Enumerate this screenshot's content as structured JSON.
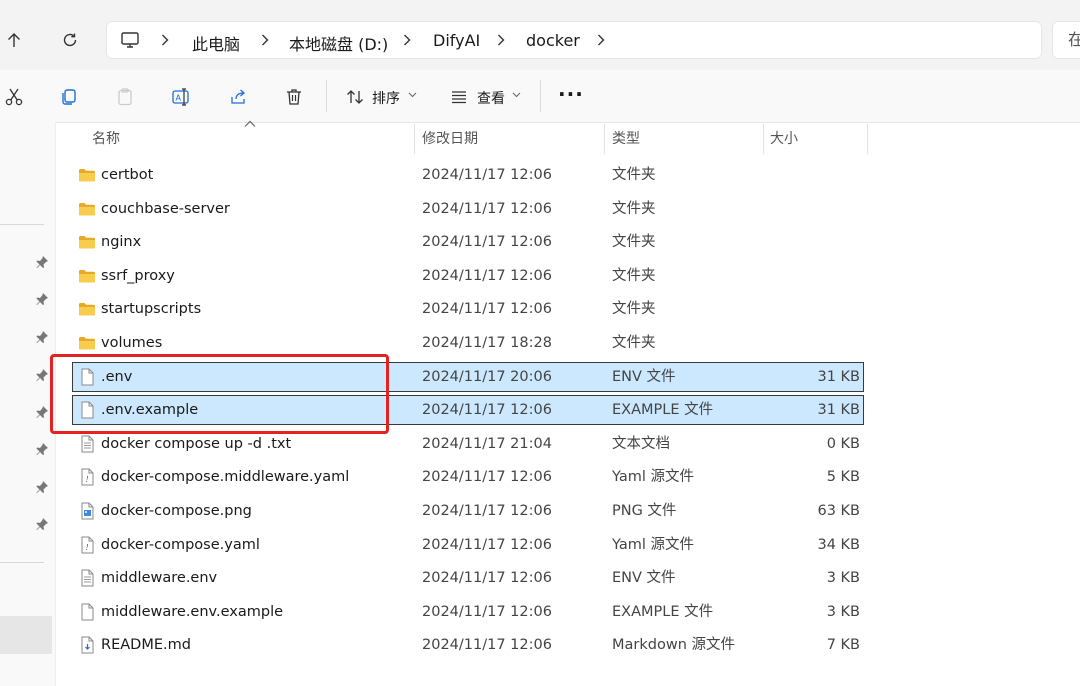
{
  "address": {
    "breadcrumbs": [
      "此电脑",
      "本地磁盘 (D:)",
      "DifyAI",
      "docker"
    ],
    "search_placeholder": "在"
  },
  "toolbar": {
    "sort_label": "排序",
    "view_label": "查看",
    "more_label": "···"
  },
  "columns": {
    "name": "名称",
    "date": "修改日期",
    "type": "类型",
    "size": "大小"
  },
  "files": [
    {
      "name": "certbot",
      "date": "2024/11/17 12:06",
      "type": "文件夹",
      "size": "",
      "icon": "folder-icon"
    },
    {
      "name": "couchbase-server",
      "date": "2024/11/17 12:06",
      "type": "文件夹",
      "size": "",
      "icon": "folder-icon"
    },
    {
      "name": "nginx",
      "date": "2024/11/17 12:06",
      "type": "文件夹",
      "size": "",
      "icon": "folder-icon"
    },
    {
      "name": "ssrf_proxy",
      "date": "2024/11/17 12:06",
      "type": "文件夹",
      "size": "",
      "icon": "folder-icon"
    },
    {
      "name": "startupscripts",
      "date": "2024/11/17 12:06",
      "type": "文件夹",
      "size": "",
      "icon": "folder-icon"
    },
    {
      "name": "volumes",
      "date": "2024/11/17 18:28",
      "type": "文件夹",
      "size": "",
      "icon": "folder-icon"
    },
    {
      "name": ".env",
      "date": "2024/11/17 20:06",
      "type": "ENV 文件",
      "size": "31 KB",
      "icon": "file-icon",
      "selected": true
    },
    {
      "name": ".env.example",
      "date": "2024/11/17 12:06",
      "type": "EXAMPLE 文件",
      "size": "31 KB",
      "icon": "file-icon",
      "selected": true
    },
    {
      "name": "docker compose up -d     .txt",
      "date": "2024/11/17 21:04",
      "type": "文本文档",
      "size": "0 KB",
      "icon": "text-file-icon"
    },
    {
      "name": "docker-compose.middleware.yaml",
      "date": "2024/11/17 12:06",
      "type": "Yaml 源文件",
      "size": "5 KB",
      "icon": "yaml-file-icon"
    },
    {
      "name": "docker-compose.png",
      "date": "2024/11/17 12:06",
      "type": "PNG 文件",
      "size": "63 KB",
      "icon": "image-file-icon"
    },
    {
      "name": "docker-compose.yaml",
      "date": "2024/11/17 12:06",
      "type": "Yaml 源文件",
      "size": "34 KB",
      "icon": "yaml-file-icon"
    },
    {
      "name": "middleware.env",
      "date": "2024/11/17 12:06",
      "type": "ENV 文件",
      "size": "3 KB",
      "icon": "text-file-icon"
    },
    {
      "name": "middleware.env.example",
      "date": "2024/11/17 12:06",
      "type": "EXAMPLE 文件",
      "size": "3 KB",
      "icon": "file-icon"
    },
    {
      "name": "README.md",
      "date": "2024/11/17 12:06",
      "type": "Markdown 源文件",
      "size": "7 KB",
      "icon": "markdown-file-icon"
    }
  ],
  "colors": {
    "selection": "#cce8ff",
    "highlight_box": "#e52222",
    "folder": "#f4c542"
  }
}
